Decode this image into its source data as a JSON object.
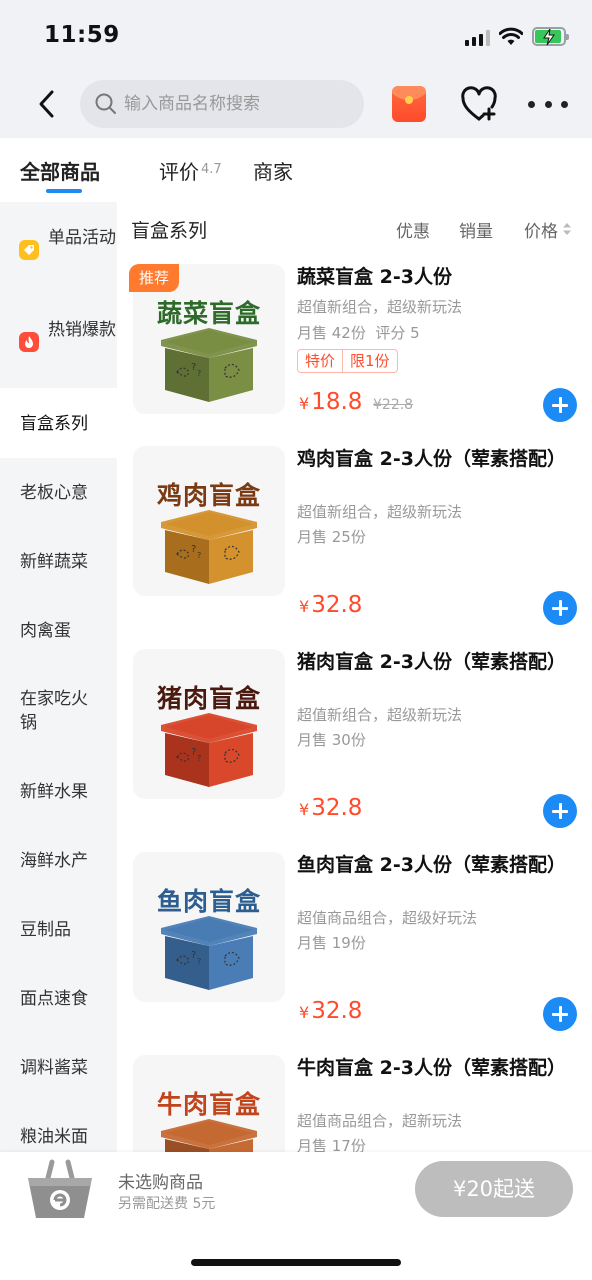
{
  "status_bar": {
    "time": "11:59"
  },
  "nav": {
    "search_placeholder": "输入商品名称搜索"
  },
  "tabs": {
    "all": "全部商品",
    "reviews": "评价",
    "reviews_score": "4.7",
    "merchant": "商家"
  },
  "sidebar": {
    "items": [
      {
        "label": "单品活动",
        "icon": "tag-icon"
      },
      {
        "label": "热销爆款",
        "icon": "flame-icon"
      },
      {
        "label": "盲盒系列"
      },
      {
        "label": "老板心意"
      },
      {
        "label": "新鲜蔬菜"
      },
      {
        "label": "肉禽蛋"
      },
      {
        "label": "在家吃火锅"
      },
      {
        "label": "新鲜水果"
      },
      {
        "label": "海鲜水产"
      },
      {
        "label": "豆制品"
      },
      {
        "label": "面点速食"
      },
      {
        "label": "调料酱菜"
      },
      {
        "label": "粮油米面"
      }
    ],
    "active_index": 2
  },
  "content": {
    "category_title": "盲盒系列",
    "sort_discount": "优惠",
    "sort_sales": "销量",
    "sort_price": "价格"
  },
  "products": [
    {
      "badge": "推荐",
      "image_text": "蔬菜盲盒",
      "name": "蔬菜盲盒 2-3人份",
      "desc": "超值新组合，超级新玩法",
      "sales": "月售 42份",
      "rating": "评分 5",
      "tag_1": "特价",
      "tag_2": "限1份",
      "currency": "¥",
      "price": "18.8",
      "original_price": "¥22.8",
      "colors": {
        "box": "#7a8e44",
        "box_dark": "#5e7034",
        "title": "#2e6b2a"
      }
    },
    {
      "image_text": "鸡肉盲盒",
      "name": "鸡肉盲盒 2-3人份（荤素搭配）",
      "desc": "超值新组合，超级新玩法",
      "sales": "月售 25份",
      "currency": "¥",
      "price": "32.8",
      "colors": {
        "box": "#d4922e",
        "box_dark": "#a86e1e",
        "title": "#7a3a14"
      }
    },
    {
      "image_text": "猪肉盲盒",
      "name": "猪肉盲盒 2-3人份（荤素搭配）",
      "desc": "超值新组合，超级新玩法",
      "sales": "月售 30份",
      "currency": "¥",
      "price": "32.8",
      "colors": {
        "box": "#d9482b",
        "box_dark": "#a9331d",
        "title": "#4a1a10"
      }
    },
    {
      "image_text": "鱼肉盲盒",
      "name": "鱼肉盲盒 2-3人份（荤素搭配）",
      "desc": "超值商品组合，超级好玩法",
      "sales": "月售 19份",
      "currency": "¥",
      "price": "32.8",
      "colors": {
        "box": "#4a7db5",
        "box_dark": "#345e8c",
        "title": "#2d5e8f"
      }
    },
    {
      "image_text": "牛肉盲盒",
      "name": "牛肉盲盒 2-3人份（荤素搭配）",
      "desc": "超值商品组合，超新玩法",
      "sales": "月售 17份",
      "currency": "¥",
      "price": "32.8",
      "colors": {
        "box": "#c66a34",
        "box_dark": "#9a4f24",
        "title": "#c0441c"
      }
    }
  ],
  "cart": {
    "status": "未选购商品",
    "fee_note": "另需配送费 5元",
    "checkout_label": "¥20起送"
  },
  "colors": {
    "accent": "#1d8bf5",
    "price_red": "#ff4b2b",
    "badge_orange": "#ff7a2e"
  }
}
